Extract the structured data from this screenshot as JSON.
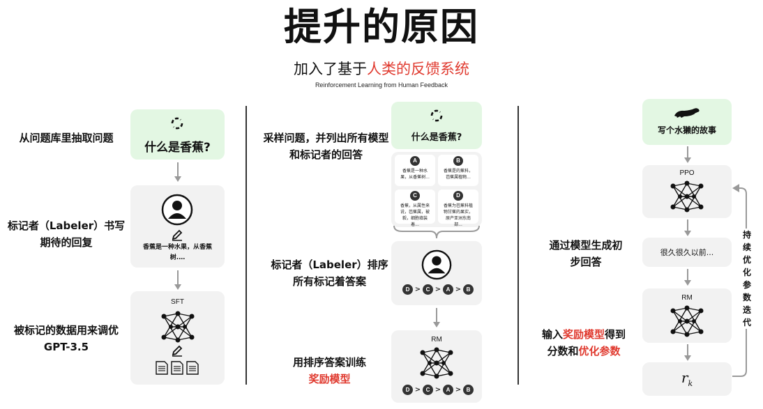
{
  "header": {
    "title": "提升的原因",
    "subtitle_prefix": "加入了基于",
    "subtitle_highlight": "人类的反馈系统",
    "subtitle_en": "Reinforcement Learning from Human Feedback"
  },
  "step1": {
    "label_sample": "从问题库里抽取问题",
    "question": "什么是香蕉?",
    "label_labeler": "标记者（Labeler）书写期待的回复",
    "answer_text": "香蕉是一种水果，从香蕉树.…",
    "label_train": "被标记的数据用来调优GPT-3.5",
    "sft_label": "SFT"
  },
  "step2": {
    "label_sample": "采样问题，并列出所有模型和标记者的回答",
    "question": "什么是香蕉?",
    "answers": [
      {
        "letter": "A",
        "text": "香蕉是一种水果，从香蕉树..."
      },
      {
        "letter": "B",
        "text": "香蕉是的蕉科，芭蕉属植物..."
      },
      {
        "letter": "C",
        "text": "香蕉，从属性来说，芭蕉属，被毅，细胞填装着..."
      },
      {
        "letter": "D",
        "text": "香蕉为芭蕉科植物甘蕉的果实，原产亚洲东南部..."
      }
    ],
    "label_rank": "标记者（Labeler）排序所有标记着答案",
    "ranking": [
      "D",
      "C",
      "A",
      "B"
    ],
    "label_train_prefix": "用排序答案训练",
    "label_train_highlight": "奖励模型",
    "rm_label": "RM"
  },
  "step3": {
    "prompt": "写个水獭的故事",
    "ppo_label": "PPO",
    "label_generate": "通过模型生成初步回答",
    "output_text": "很久很久以前...",
    "rm_label": "RM",
    "label_input_prefix": "输入",
    "label_input_highlight": "奖励模型",
    "label_input_mid": "得到",
    "label_input_line2_prefix": "分数和",
    "label_input_line2_highlight": "优化参数",
    "reward_symbol": "r",
    "reward_sub": "k",
    "loop_label": "持续优化参数迭代"
  },
  "colors": {
    "accent_red": "#e03a2f",
    "green_box": "#e3f7e3",
    "gray_box": "#f2f2f2",
    "arrow": "#999999"
  }
}
